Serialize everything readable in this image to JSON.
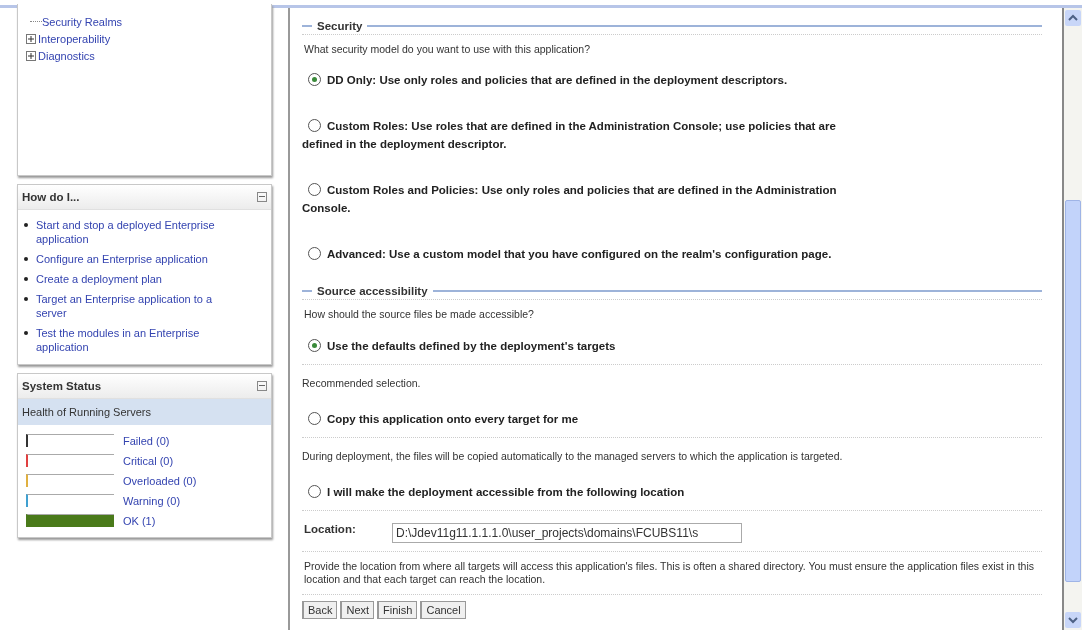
{
  "tree": {
    "items": [
      {
        "label": "Security Realms",
        "expandable": false
      },
      {
        "label": "Interoperability",
        "expandable": true
      },
      {
        "label": "Diagnostics",
        "expandable": true
      }
    ]
  },
  "how_do_i": {
    "title": "How do I...",
    "links": [
      "Start and stop a deployed Enterprise application",
      "Configure an Enterprise application",
      "Create a deployment plan",
      "Target an Enterprise application to a server",
      "Test the modules in an Enterprise application"
    ]
  },
  "system_status": {
    "title": "System Status",
    "subtitle": "Health of Running Servers",
    "items": [
      {
        "label": "Failed (0)",
        "level": 0,
        "color": "#333333"
      },
      {
        "label": "Critical (0)",
        "level": 0,
        "color": "#e04040"
      },
      {
        "label": "Overloaded (0)",
        "level": 0,
        "color": "#e0b040"
      },
      {
        "label": "Warning (0)",
        "level": 0,
        "color": "#40a0d0"
      },
      {
        "label": "OK (1)",
        "level": 1,
        "color": "#4a7a1a"
      }
    ]
  },
  "security": {
    "title": "Security",
    "question": "What security model do you want to use with this application?",
    "options": [
      {
        "label": "DD Only: Use only roles and policies that are defined in the deployment descriptors.",
        "selected": true
      },
      {
        "label": "Custom Roles: Use roles that are defined in the Administration Console; use policies that are defined in the deployment descriptor.",
        "selected": false
      },
      {
        "label": "Custom Roles and Policies: Use only roles and policies that are defined in the Administration Console.",
        "selected": false
      },
      {
        "label": "Advanced: Use a custom model that you have configured on the realm's configuration page.",
        "selected": false
      }
    ]
  },
  "source_accessibility": {
    "title": "Source accessibility",
    "question": "How should the source files be made accessible?",
    "options": [
      {
        "label": "Use the defaults defined by the deployment's targets",
        "selected": true,
        "note": "Recommended selection."
      },
      {
        "label": "Copy this application onto every target for me",
        "selected": false,
        "note": "During deployment, the files will be copied automatically to the managed servers to which the application is targeted."
      },
      {
        "label": "I will make the deployment accessible from the following location",
        "selected": false
      }
    ],
    "location": {
      "label": "Location:",
      "value": "D:\\Jdev11g11.1.1.1.0\\user_projects\\domains\\FCUBS11\\s"
    },
    "help": "Provide the location from where all targets will access this application's files. This is often a shared directory. You must ensure the application files exist in this location and that each target can reach the location."
  },
  "buttons": [
    "Back",
    "Next",
    "Finish",
    "Cancel"
  ]
}
